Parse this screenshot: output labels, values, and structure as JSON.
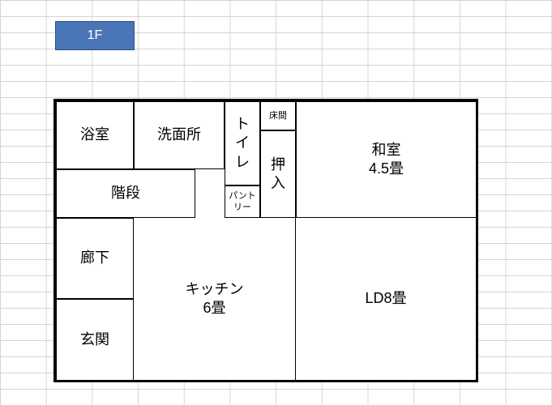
{
  "badge": {
    "label": "1F"
  },
  "rooms": {
    "bath": {
      "label": "浴室"
    },
    "washroom": {
      "label": "洗面所"
    },
    "toilet": {
      "line1": "ト",
      "line2": "イ",
      "line3": "レ"
    },
    "pantry": {
      "line1": "パント",
      "line2": "リー"
    },
    "tokonoma": {
      "label": "床間"
    },
    "oshiire": {
      "line1": "押",
      "line2": "入"
    },
    "washitsu": {
      "line1": "和室",
      "line2": "4.5畳"
    },
    "stairs": {
      "label": "階段"
    },
    "corridor": {
      "label": "廊下"
    },
    "genkan": {
      "label": "玄関"
    },
    "kitchen": {
      "line1": "キッチン",
      "line2": "6畳"
    },
    "ld": {
      "label": "LD8畳"
    }
  }
}
